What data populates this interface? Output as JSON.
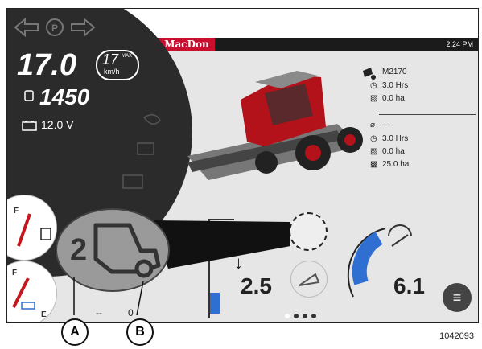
{
  "header": {
    "brand": "MacDon",
    "time": "2:24 PM"
  },
  "left_panel": {
    "speed": "17.0",
    "speed_limit": "17",
    "speed_limit_tag": "MAX",
    "speed_unit": "km/h",
    "engine_rpm": "1450",
    "battery": "12.0 V"
  },
  "machine_stats": {
    "model": "M2170",
    "machine_hours": "3.0 Hrs",
    "machine_area": "0.0 ha",
    "header_value": "—",
    "header_hours": "3.0 Hrs",
    "header_area": "0.0 ha",
    "total_area": "25.0 ha"
  },
  "controls": {
    "left_value": "2.5",
    "right_value": "6.1",
    "bottom_dashes": "--",
    "bottom_value": "0"
  },
  "zoom": {
    "gear_number": "2"
  },
  "callouts": {
    "a": "A",
    "b": "B"
  },
  "figure_id": "1042093",
  "colors": {
    "brand_red": "#c8102e",
    "dark_panel": "#2b2b2b",
    "accent_blue": "#2f6fd1",
    "gauge_red": "#c4161c"
  }
}
